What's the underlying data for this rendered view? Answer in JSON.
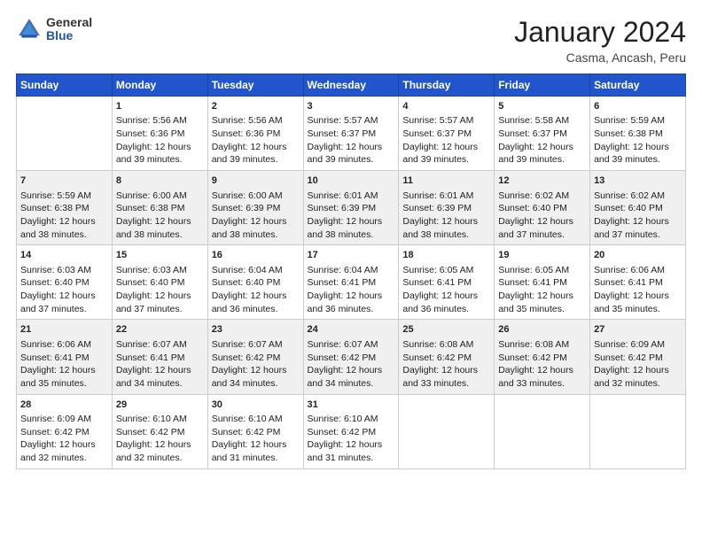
{
  "header": {
    "logo_general": "General",
    "logo_blue": "Blue",
    "month_year": "January 2024",
    "location": "Casma, Ancash, Peru"
  },
  "days_of_week": [
    "Sunday",
    "Monday",
    "Tuesday",
    "Wednesday",
    "Thursday",
    "Friday",
    "Saturday"
  ],
  "weeks": [
    [
      {
        "day": "",
        "sunrise": "",
        "sunset": "",
        "daylight": ""
      },
      {
        "day": "1",
        "sunrise": "Sunrise: 5:56 AM",
        "sunset": "Sunset: 6:36 PM",
        "daylight": "Daylight: 12 hours and 39 minutes."
      },
      {
        "day": "2",
        "sunrise": "Sunrise: 5:56 AM",
        "sunset": "Sunset: 6:36 PM",
        "daylight": "Daylight: 12 hours and 39 minutes."
      },
      {
        "day": "3",
        "sunrise": "Sunrise: 5:57 AM",
        "sunset": "Sunset: 6:37 PM",
        "daylight": "Daylight: 12 hours and 39 minutes."
      },
      {
        "day": "4",
        "sunrise": "Sunrise: 5:57 AM",
        "sunset": "Sunset: 6:37 PM",
        "daylight": "Daylight: 12 hours and 39 minutes."
      },
      {
        "day": "5",
        "sunrise": "Sunrise: 5:58 AM",
        "sunset": "Sunset: 6:37 PM",
        "daylight": "Daylight: 12 hours and 39 minutes."
      },
      {
        "day": "6",
        "sunrise": "Sunrise: 5:59 AM",
        "sunset": "Sunset: 6:38 PM",
        "daylight": "Daylight: 12 hours and 39 minutes."
      }
    ],
    [
      {
        "day": "7",
        "sunrise": "Sunrise: 5:59 AM",
        "sunset": "Sunset: 6:38 PM",
        "daylight": "Daylight: 12 hours and 38 minutes."
      },
      {
        "day": "8",
        "sunrise": "Sunrise: 6:00 AM",
        "sunset": "Sunset: 6:38 PM",
        "daylight": "Daylight: 12 hours and 38 minutes."
      },
      {
        "day": "9",
        "sunrise": "Sunrise: 6:00 AM",
        "sunset": "Sunset: 6:39 PM",
        "daylight": "Daylight: 12 hours and 38 minutes."
      },
      {
        "day": "10",
        "sunrise": "Sunrise: 6:01 AM",
        "sunset": "Sunset: 6:39 PM",
        "daylight": "Daylight: 12 hours and 38 minutes."
      },
      {
        "day": "11",
        "sunrise": "Sunrise: 6:01 AM",
        "sunset": "Sunset: 6:39 PM",
        "daylight": "Daylight: 12 hours and 38 minutes."
      },
      {
        "day": "12",
        "sunrise": "Sunrise: 6:02 AM",
        "sunset": "Sunset: 6:40 PM",
        "daylight": "Daylight: 12 hours and 37 minutes."
      },
      {
        "day": "13",
        "sunrise": "Sunrise: 6:02 AM",
        "sunset": "Sunset: 6:40 PM",
        "daylight": "Daylight: 12 hours and 37 minutes."
      }
    ],
    [
      {
        "day": "14",
        "sunrise": "Sunrise: 6:03 AM",
        "sunset": "Sunset: 6:40 PM",
        "daylight": "Daylight: 12 hours and 37 minutes."
      },
      {
        "day": "15",
        "sunrise": "Sunrise: 6:03 AM",
        "sunset": "Sunset: 6:40 PM",
        "daylight": "Daylight: 12 hours and 37 minutes."
      },
      {
        "day": "16",
        "sunrise": "Sunrise: 6:04 AM",
        "sunset": "Sunset: 6:40 PM",
        "daylight": "Daylight: 12 hours and 36 minutes."
      },
      {
        "day": "17",
        "sunrise": "Sunrise: 6:04 AM",
        "sunset": "Sunset: 6:41 PM",
        "daylight": "Daylight: 12 hours and 36 minutes."
      },
      {
        "day": "18",
        "sunrise": "Sunrise: 6:05 AM",
        "sunset": "Sunset: 6:41 PM",
        "daylight": "Daylight: 12 hours and 36 minutes."
      },
      {
        "day": "19",
        "sunrise": "Sunrise: 6:05 AM",
        "sunset": "Sunset: 6:41 PM",
        "daylight": "Daylight: 12 hours and 35 minutes."
      },
      {
        "day": "20",
        "sunrise": "Sunrise: 6:06 AM",
        "sunset": "Sunset: 6:41 PM",
        "daylight": "Daylight: 12 hours and 35 minutes."
      }
    ],
    [
      {
        "day": "21",
        "sunrise": "Sunrise: 6:06 AM",
        "sunset": "Sunset: 6:41 PM",
        "daylight": "Daylight: 12 hours and 35 minutes."
      },
      {
        "day": "22",
        "sunrise": "Sunrise: 6:07 AM",
        "sunset": "Sunset: 6:41 PM",
        "daylight": "Daylight: 12 hours and 34 minutes."
      },
      {
        "day": "23",
        "sunrise": "Sunrise: 6:07 AM",
        "sunset": "Sunset: 6:42 PM",
        "daylight": "Daylight: 12 hours and 34 minutes."
      },
      {
        "day": "24",
        "sunrise": "Sunrise: 6:07 AM",
        "sunset": "Sunset: 6:42 PM",
        "daylight": "Daylight: 12 hours and 34 minutes."
      },
      {
        "day": "25",
        "sunrise": "Sunrise: 6:08 AM",
        "sunset": "Sunset: 6:42 PM",
        "daylight": "Daylight: 12 hours and 33 minutes."
      },
      {
        "day": "26",
        "sunrise": "Sunrise: 6:08 AM",
        "sunset": "Sunset: 6:42 PM",
        "daylight": "Daylight: 12 hours and 33 minutes."
      },
      {
        "day": "27",
        "sunrise": "Sunrise: 6:09 AM",
        "sunset": "Sunset: 6:42 PM",
        "daylight": "Daylight: 12 hours and 32 minutes."
      }
    ],
    [
      {
        "day": "28",
        "sunrise": "Sunrise: 6:09 AM",
        "sunset": "Sunset: 6:42 PM",
        "daylight": "Daylight: 12 hours and 32 minutes."
      },
      {
        "day": "29",
        "sunrise": "Sunrise: 6:10 AM",
        "sunset": "Sunset: 6:42 PM",
        "daylight": "Daylight: 12 hours and 32 minutes."
      },
      {
        "day": "30",
        "sunrise": "Sunrise: 6:10 AM",
        "sunset": "Sunset: 6:42 PM",
        "daylight": "Daylight: 12 hours and 31 minutes."
      },
      {
        "day": "31",
        "sunrise": "Sunrise: 6:10 AM",
        "sunset": "Sunset: 6:42 PM",
        "daylight": "Daylight: 12 hours and 31 minutes."
      },
      {
        "day": "",
        "sunrise": "",
        "sunset": "",
        "daylight": ""
      },
      {
        "day": "",
        "sunrise": "",
        "sunset": "",
        "daylight": ""
      },
      {
        "day": "",
        "sunrise": "",
        "sunset": "",
        "daylight": ""
      }
    ]
  ]
}
